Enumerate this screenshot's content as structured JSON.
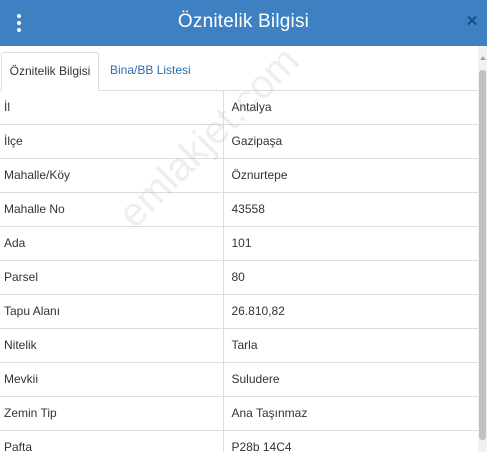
{
  "header": {
    "title": "Öznitelik Bilgisi",
    "close_glyph": "×",
    "background_color": "#3e81c3"
  },
  "tabs": [
    {
      "label": "Öznitelik Bilgisi",
      "active": true
    },
    {
      "label": "Bina/BB Listesi",
      "active": false
    }
  ],
  "rows": [
    {
      "key": "İl",
      "value": "Antalya"
    },
    {
      "key": "İlçe",
      "value": "Gazipaşa"
    },
    {
      "key": "Mahalle/Köy",
      "value": "Öznurtepe"
    },
    {
      "key": "Mahalle No",
      "value": "43558"
    },
    {
      "key": "Ada",
      "value": "101"
    },
    {
      "key": "Parsel",
      "value": "80"
    },
    {
      "key": "Tapu Alanı",
      "value": "26.810,82"
    },
    {
      "key": "Nitelik",
      "value": "Tarla"
    },
    {
      "key": "Mevkii",
      "value": "Suludere"
    },
    {
      "key": "Zemin Tip",
      "value": "Ana Taşınmaz"
    },
    {
      "key": "Pafta",
      "value": "P28b 14C4"
    }
  ],
  "watermark": "emlakjet.com"
}
